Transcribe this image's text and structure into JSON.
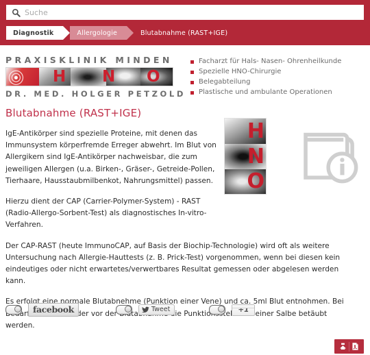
{
  "search": {
    "placeholder": "Suche",
    "value": "",
    "icon": "search-icon"
  },
  "breadcrumb": {
    "items": [
      {
        "label": "Diagnostik",
        "style": "active-white"
      },
      {
        "label": "Allergologie",
        "style": "pink"
      },
      {
        "label": "Blutabnahme (RAST+IGE)",
        "style": "plain"
      }
    ]
  },
  "brand": {
    "line_top": "PRAXISKLINIK MINDEN",
    "line_bottom": "DR. MED. HOLGER PETZOLD",
    "strip_letters": [
      "H",
      "N",
      "O"
    ]
  },
  "claims": {
    "items": [
      "Facharzt für Hals- Nasen- Ohrenheilkunde",
      "Spezielle HNO-Chirurgie",
      "Belegabteilung",
      "Plastische und ambulante Operationen"
    ]
  },
  "main": {
    "title": "Blutabnahme (RAST+IGE)",
    "paragraphs": [
      "IgE-Antikörper sind spezielle Proteine, mit denen das Immunsystem körperfremde Erreger abwehrt. Im Blut von Allergikern sind IgE-Antikörper nachweisbar, die zum jeweiligen Allergen (u.a. Birken-, Gräser-, Getreide-Pollen, Tierhaare, Hausstaubmilbenkot, Nahrungsmittel) passen.",
      "Hierzu dient der CAP (Carrier-Polymer-System) - RAST (Radio-Allergo-Sorbent-Test) als diagnostisches In-vitro-Verfahren.",
      "Der CAP-RAST (heute ImmunoCAP, auf Basis der Biochip-Technologie) wird oft als weitere Untersuchung nach Allergie-Hauttests (z. B. Prick-Test) vorgenommen, wenn bei diesen kein eindeutiges oder nicht erwartetes/verwertbares Resultat gemessen oder abgelesen werden kann.",
      "Es erfolgt eine normale Blutabnehme (Punktion einer Vene) und ca. 5ml Blut entnohmen. Bei Bedarf kann bei Kinder vor der Blutabnahme die Punktionsstelle mit einer Salbe betäubt werden."
    ],
    "figure": {
      "photo_letters": [
        "H",
        "N",
        "O"
      ],
      "icon_name": "book-info-icon"
    }
  },
  "social": {
    "items": [
      {
        "name": "facebook",
        "label": "facebook",
        "toggle_state": "off"
      },
      {
        "name": "twitter",
        "label": "Tweet",
        "toggle_state": "off"
      },
      {
        "name": "googleplus",
        "label": "+1",
        "toggle_state": "off"
      }
    ]
  },
  "tools": {
    "print_label": "print-icon",
    "pdf_label": "pdf-icon"
  },
  "colors": {
    "banner_red": "#b32838",
    "accent_red": "#c0304a",
    "breadcrumb_pink": "#d88b96",
    "bullet_red": "#c0202f",
    "logo_gray": "#6e6e6e",
    "tools_red": "#b52d3d"
  }
}
